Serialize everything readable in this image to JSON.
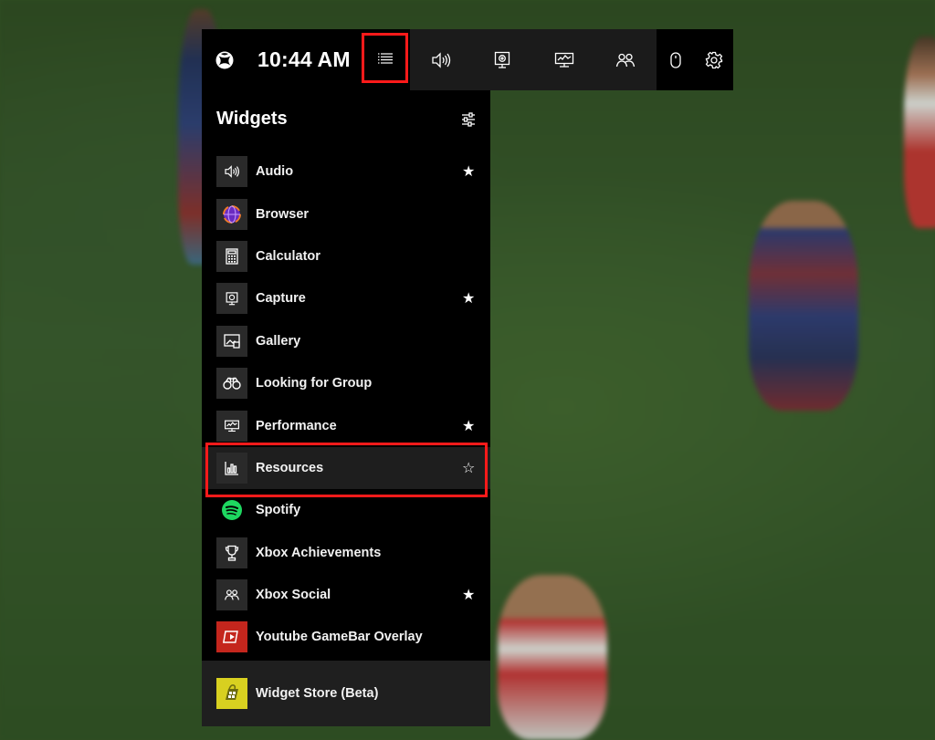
{
  "topbar": {
    "time": "10:44 AM",
    "quick_widgets": [
      "speaker-icon",
      "capture-icon",
      "performance-icon",
      "social-icon"
    ],
    "right_icons": [
      "mouse-icon",
      "gear-icon"
    ],
    "highlight_color": "#ff1a1a"
  },
  "panel": {
    "title": "Widgets",
    "items": [
      {
        "label": "Audio",
        "icon": "speaker-icon",
        "favorite": true
      },
      {
        "label": "Browser",
        "icon": "browser-icon",
        "favorite": false
      },
      {
        "label": "Calculator",
        "icon": "calculator-icon",
        "favorite": false
      },
      {
        "label": "Capture",
        "icon": "capture-icon",
        "favorite": true
      },
      {
        "label": "Gallery",
        "icon": "gallery-icon",
        "favorite": false
      },
      {
        "label": "Looking for Group",
        "icon": "binoculars-icon",
        "favorite": false
      },
      {
        "label": "Performance",
        "icon": "performance-icon",
        "favorite": true
      },
      {
        "label": "Resources",
        "icon": "bar-chart-icon",
        "favorite": false
      },
      {
        "label": "Spotify",
        "icon": "spotify-icon",
        "favorite": false
      },
      {
        "label": "Xbox Achievements",
        "icon": "trophy-icon",
        "favorite": false
      },
      {
        "label": "Xbox Social",
        "icon": "social-icon",
        "favorite": true
      },
      {
        "label": "Youtube GameBar Overlay",
        "icon": "youtube-overlay-icon",
        "favorite": false
      }
    ],
    "store_label": "Widget Store (Beta)",
    "star_filled": "★",
    "star_empty": "☆"
  }
}
